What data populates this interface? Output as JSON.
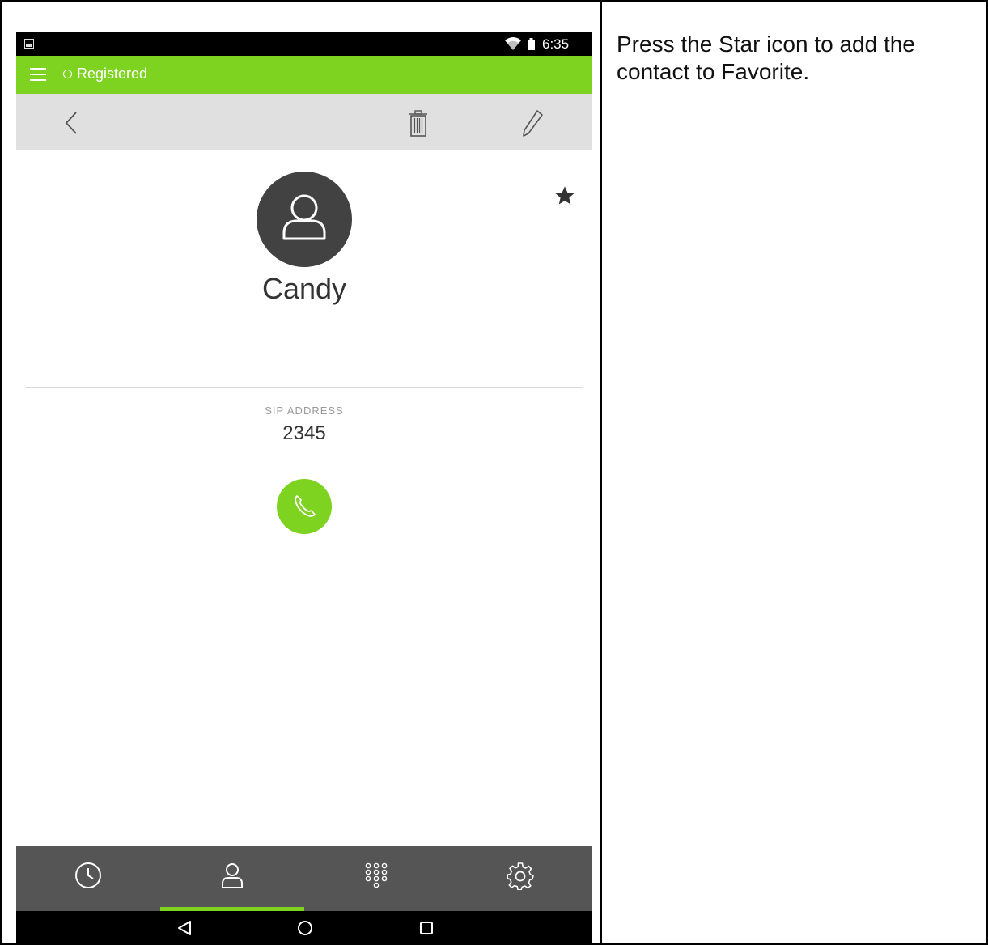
{
  "status_bar": {
    "time": "6:35"
  },
  "app_bar": {
    "status_text": "Registered",
    "accent_color": "#7ed321"
  },
  "contact": {
    "name": "Candy",
    "sip_label": "SIP ADDRESS",
    "sip_value": "2345"
  },
  "icons": {
    "menu": "hamburger-menu-icon",
    "back": "chevron-left-icon",
    "delete": "trash-icon",
    "edit": "pencil-icon",
    "favorite": "star-icon",
    "call": "phone-icon"
  },
  "bottom_nav": {
    "items": [
      "history-clock-icon",
      "contacts-person-icon",
      "dialpad-icon",
      "settings-gear-icon"
    ],
    "active_index": 1
  },
  "system_nav": [
    "back-triangle-icon",
    "home-circle-icon",
    "recents-square-icon"
  ],
  "instruction": {
    "text": "Press the Star icon to add the contact to Favorite."
  }
}
